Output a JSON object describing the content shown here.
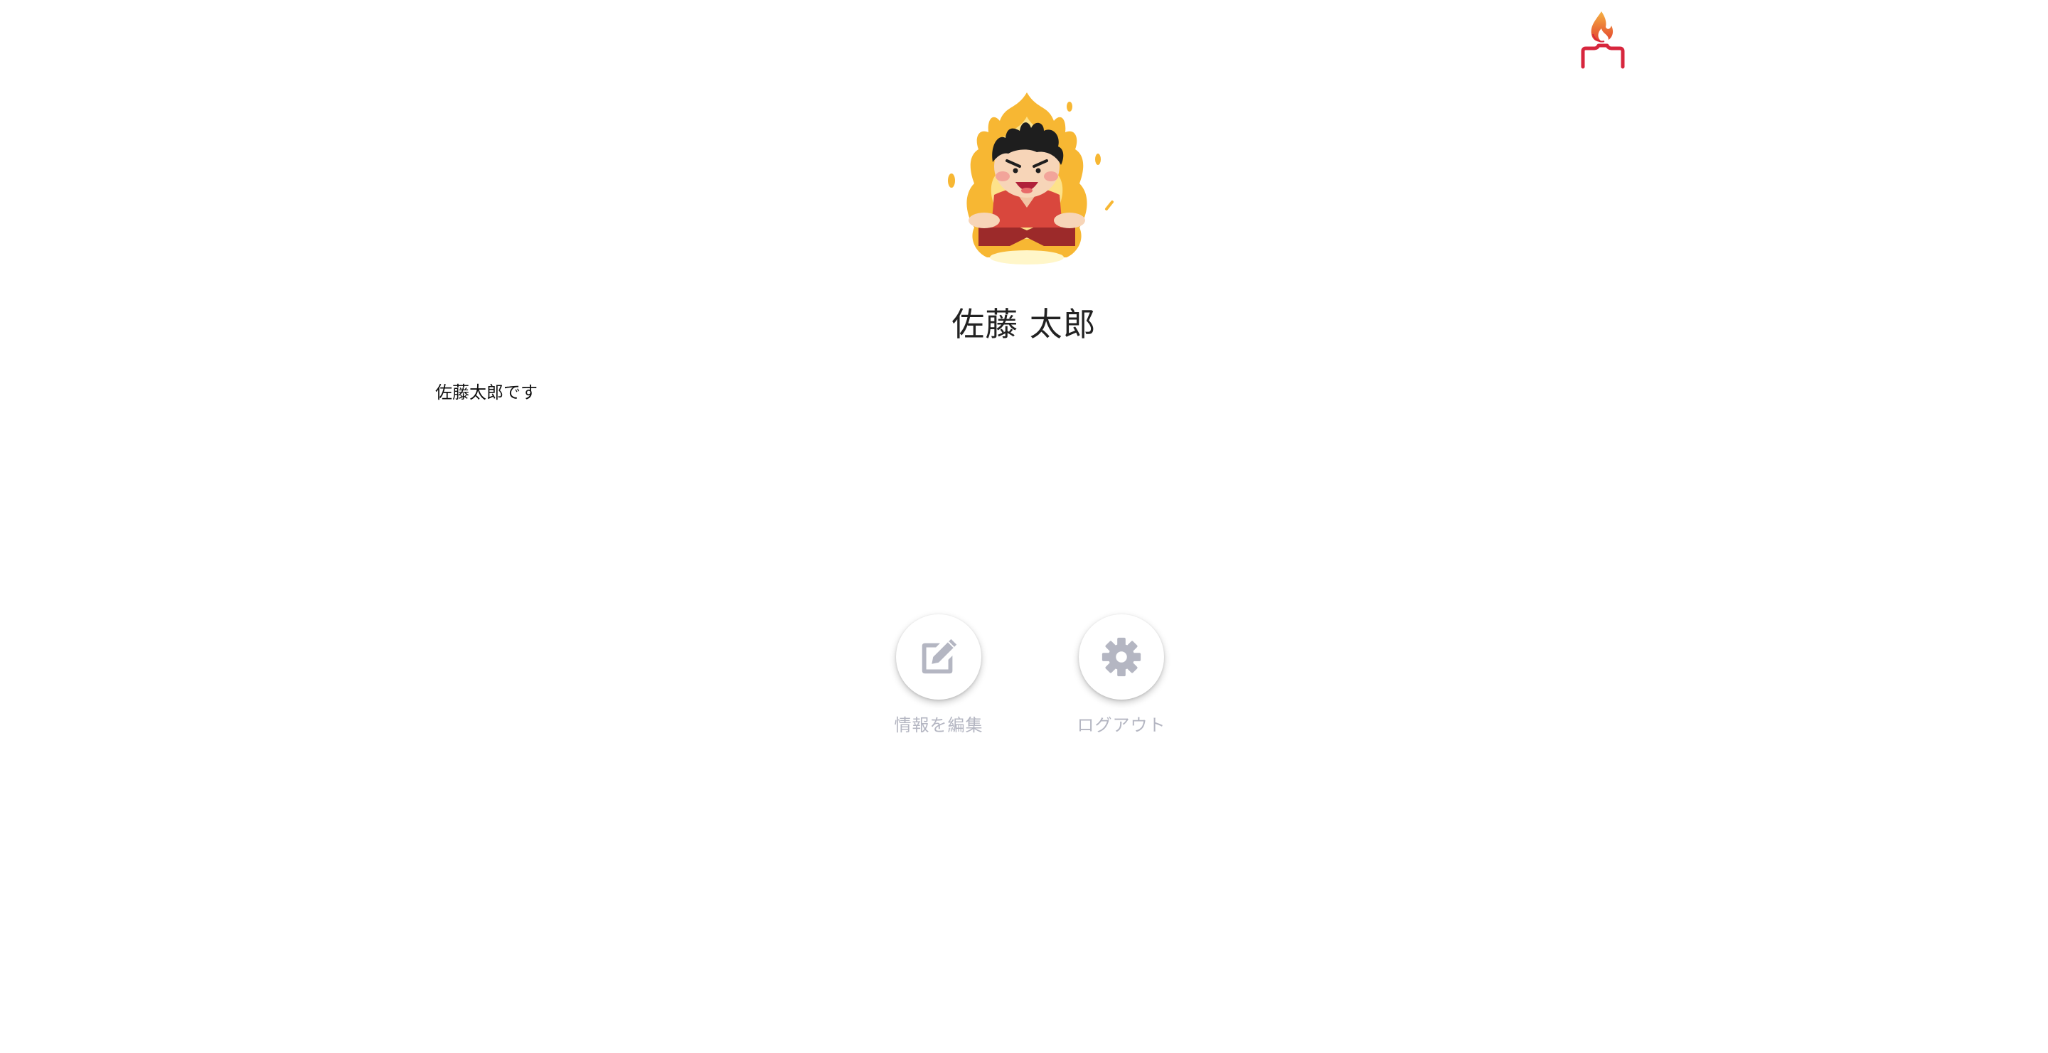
{
  "header": {
    "logo_icon": "flame-logo-icon"
  },
  "profile": {
    "avatar_icon": "burning-character-avatar",
    "name": "佐藤 太郎",
    "bio": "佐藤太郎です"
  },
  "actions": [
    {
      "id": "edit",
      "icon": "edit-icon",
      "label": "情報を編集"
    },
    {
      "id": "logout",
      "icon": "gear-icon",
      "label": "ログアウト"
    }
  ],
  "colors": {
    "action_icon": "#b4b6c2",
    "action_label": "#b4b6c2",
    "logo_flame_top": "#f2a93b",
    "logo_flame_bottom": "#e04a2f",
    "logo_base": "#d7263d"
  }
}
